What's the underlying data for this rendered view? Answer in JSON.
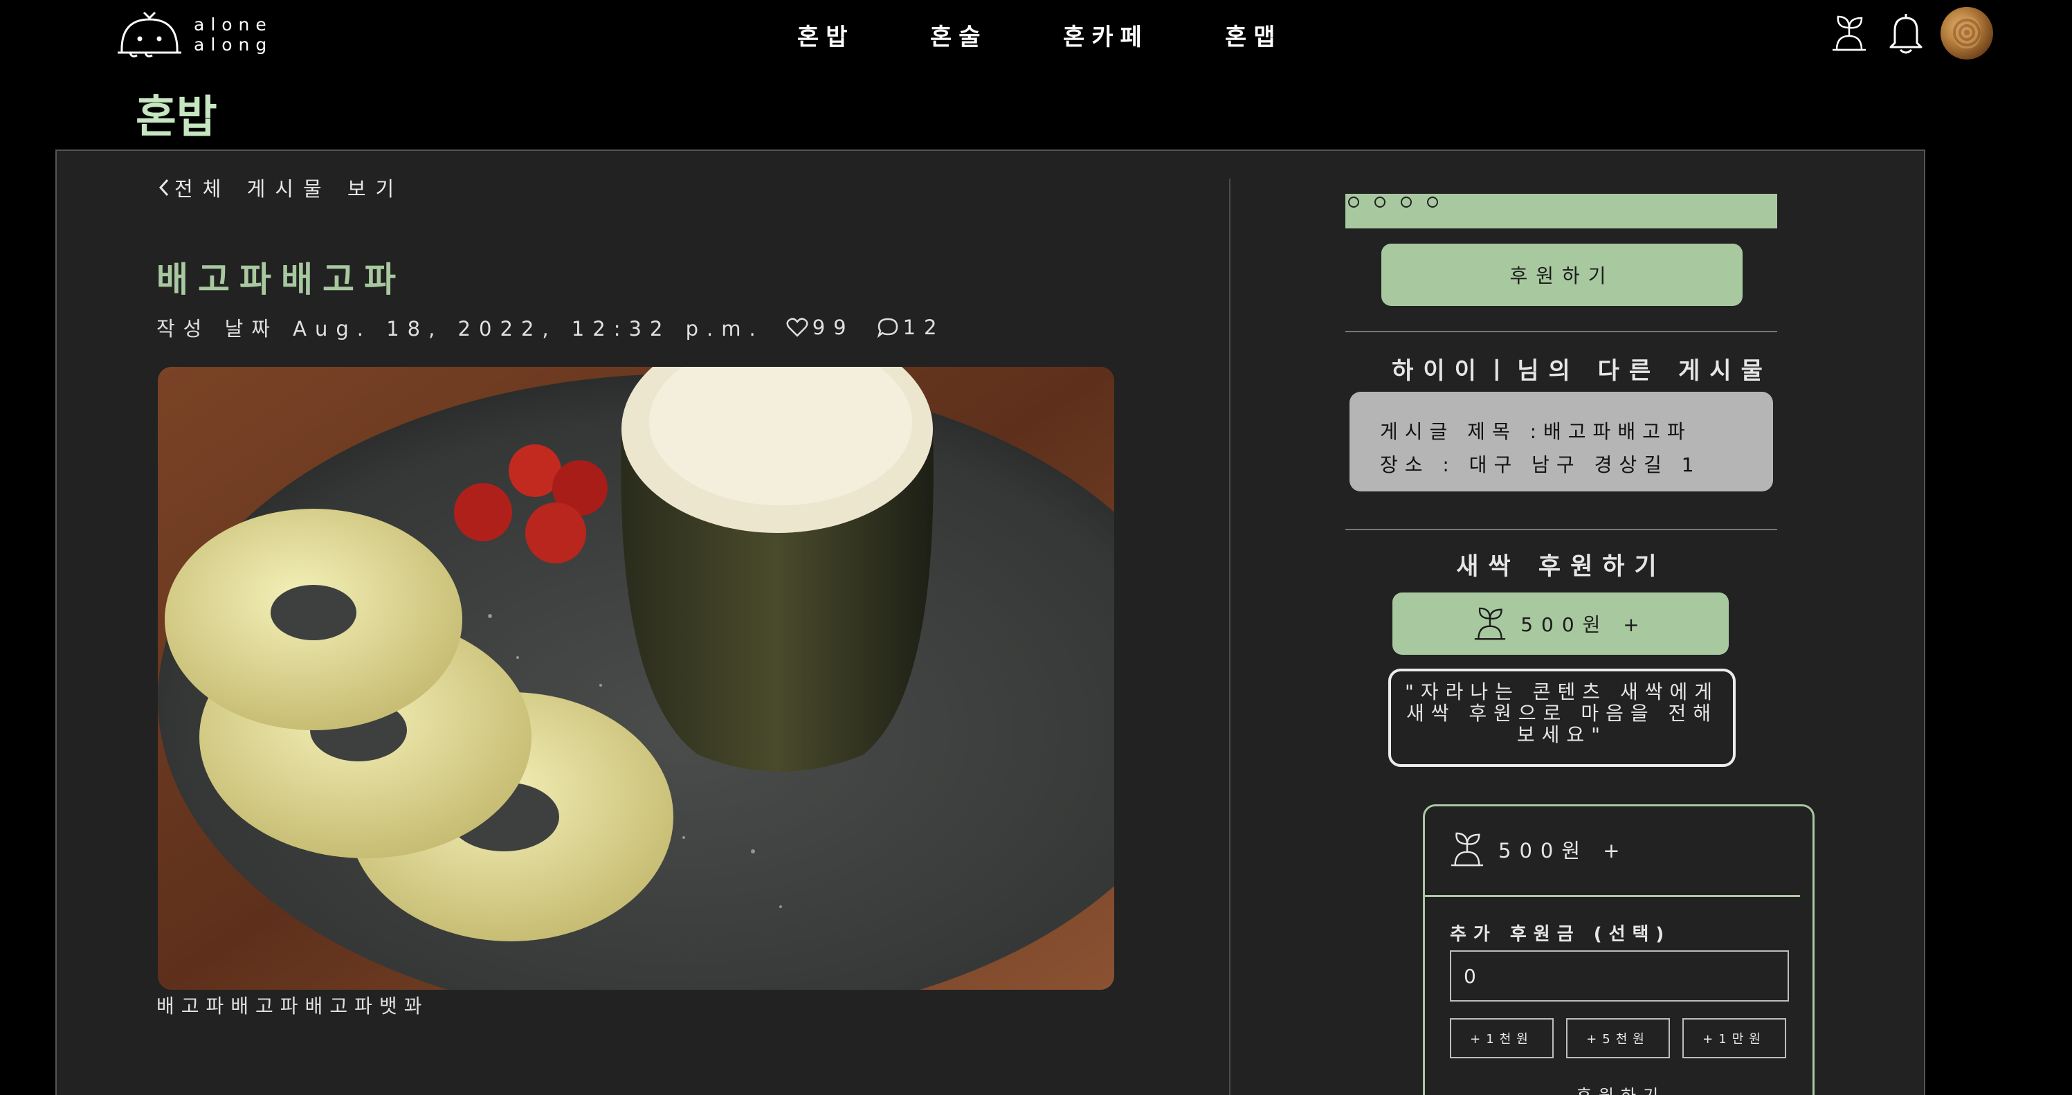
{
  "brand": {
    "logo_line1": "alone",
    "logo_line2": "along"
  },
  "nav": [
    {
      "label": "혼밥"
    },
    {
      "label": "혼술"
    },
    {
      "label": "혼카페"
    },
    {
      "label": "혼맵"
    }
  ],
  "icons": {
    "sprout": "sprout-icon",
    "bell": "bell-icon",
    "avatar": "profile-avatar"
  },
  "page": {
    "title": "혼밥"
  },
  "post": {
    "back_label": "전체 게시물 보기",
    "title": "배고파배고파",
    "date": "작성 날짜 Aug. 18, 2022, 12:32 p.m.",
    "likes": "99",
    "comments": "12",
    "caption": "배고파배고파배고파뱃꽈"
  },
  "sidebar": {
    "progress_dots": 4,
    "sponsor_button": "후원하기",
    "other_posts_title": "하이이ㅣ님의 다른 게시물",
    "other_post": {
      "title": "게시글 제목 :배고파배고파",
      "location": "장소 : 대구 남구 경상길 1"
    },
    "sprout_title": "새싹 후원하기",
    "amount_button": "500원 +",
    "quote": "\"자라나는 콘텐츠 새싹에게 새싹 후원으로 마음을 전해보세요\"",
    "donate": {
      "amount": "500원 +",
      "extra_label": "추가 후원금 (선택)",
      "extra_value": "0",
      "quick": [
        "+1천원",
        "+5천원",
        "+1만원"
      ],
      "submit": "후원하기"
    }
  },
  "colors": {
    "accent": "#a8c9a0",
    "title_green": "#c5e6c0",
    "panel": "#222222",
    "card": "#b5b5b5"
  }
}
